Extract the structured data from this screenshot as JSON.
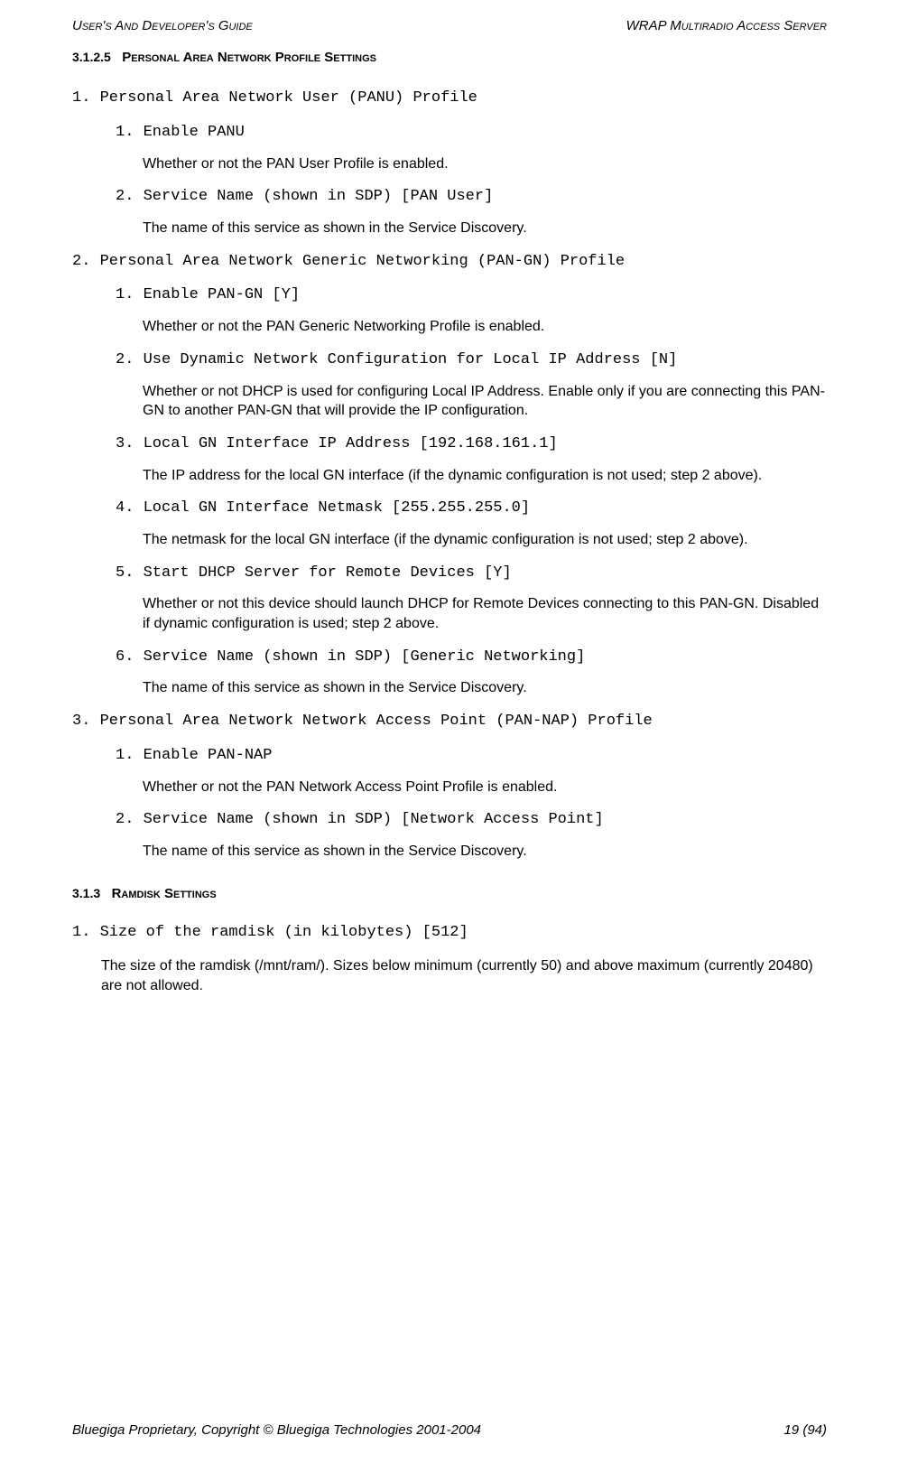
{
  "header": {
    "left": "User's And Developer's Guide",
    "right": "WRAP Multiradio Access Server"
  },
  "section1": {
    "num": "3.1.2.5",
    "title": "Personal Area Network Profile Settings"
  },
  "p1": {
    "title": "1. Personal Area Network User (PANU) Profile",
    "i1": {
      "title": "1. Enable PANU",
      "text": "Whether or not the PAN User Profile is enabled."
    },
    "i2": {
      "title": "2. Service Name (shown in SDP)  [PAN User]",
      "text": "The name of this service as shown in the Service Discovery."
    }
  },
  "p2": {
    "title": "2. Personal Area Network Generic Networking (PAN-GN) Profile",
    "i1": {
      "title": "1. Enable PAN-GN [Y]",
      "text": "Whether or not the PAN Generic Networking Profile is enabled."
    },
    "i2": {
      "title": "2. Use Dynamic Network Configuration for Local IP Address [N]",
      "text": "Whether or not DHCP is used for configuring Local IP Address. Enable only if you are connecting this PAN-GN to another PAN-GN that will provide the IP configuration."
    },
    "i3": {
      "title": "3. Local GN Interface IP Address [192.168.161.1]",
      "text": "The IP address for the local GN interface (if the dynamic configuration is not used; step 2 above)."
    },
    "i4": {
      "title": "4. Local GN Interface Netmask [255.255.255.0]",
      "text": "The netmask for the local GN interface (if the dynamic configuration is not used; step 2 above)."
    },
    "i5": {
      "title": "5. Start DHCP Server for Remote Devices [Y]",
      "text": "Whether or not this device should launch DHCP for Remote Devices connecting to this PAN-GN. Disabled if dynamic configuration is used; step 2 above."
    },
    "i6": {
      "title": "6. Service Name (shown in SDP) [Generic Networking]",
      "text": "The name of this service as shown in the Service Discovery."
    }
  },
  "p3": {
    "title": "3. Personal Area Network Network Access Point (PAN-NAP) Profile",
    "i1": {
      "title": "1. Enable PAN-NAP",
      "text": "Whether or not the PAN Network Access Point Profile is enabled."
    },
    "i2": {
      "title": "2. Service Name (shown in SDP)  [Network Access Point]",
      "text": "The name of this service as shown in the Service Discovery."
    }
  },
  "section2": {
    "num": "3.1.3",
    "title": "Ramdisk Settings"
  },
  "r1": {
    "title": "1. Size of the ramdisk (in kilobytes) [512]",
    "text": "The size of the ramdisk (/mnt/ram/). Sizes below minimum (currently 50) and above maximum (currently 20480) are not allowed."
  },
  "footer": {
    "left": "Bluegiga Proprietary, Copyright © Bluegiga Technologies 2001-2004",
    "right": "19 (94)"
  }
}
